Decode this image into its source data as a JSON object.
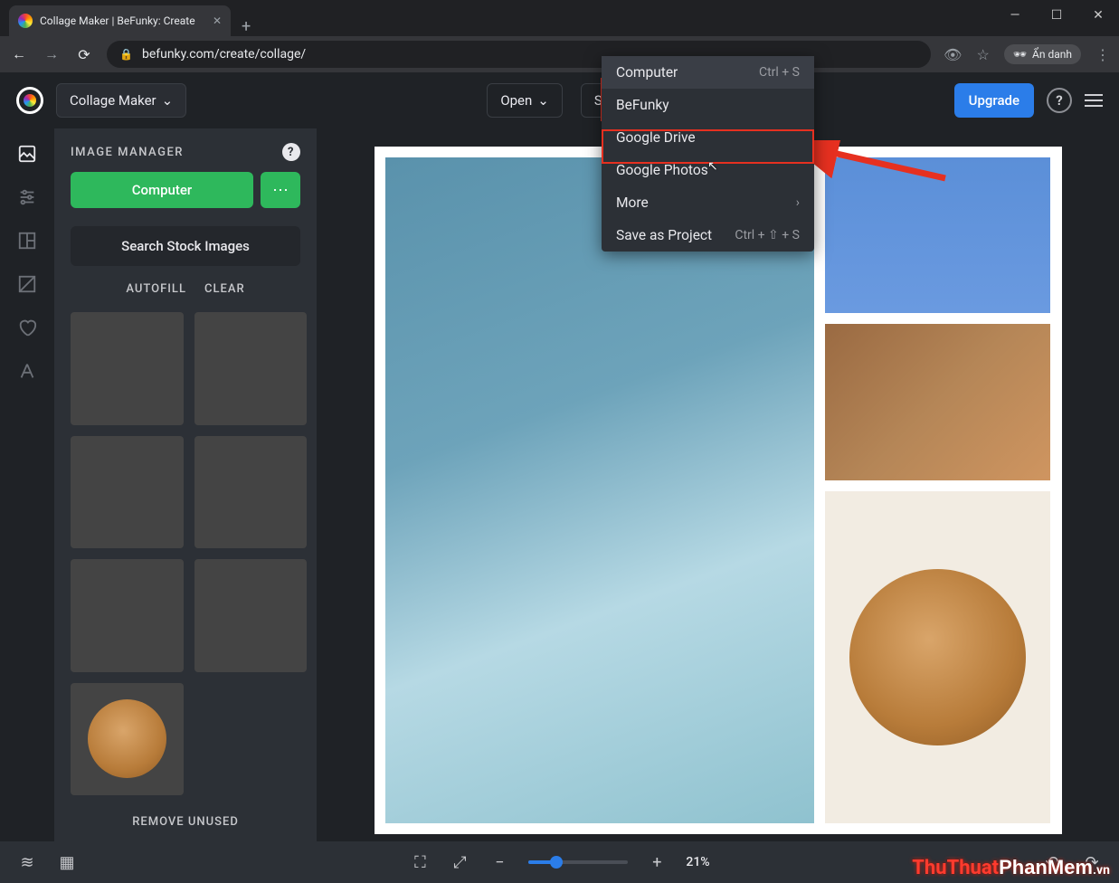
{
  "browser": {
    "tab_title": "Collage Maker | BeFunky: Create",
    "url": "befunky.com/create/collage/",
    "incognito_label": "Ẩn danh"
  },
  "header": {
    "app_switcher": "Collage Maker",
    "open": "Open",
    "save": "Save",
    "upgrade": "Upgrade"
  },
  "save_menu": {
    "items": [
      {
        "label": "Computer",
        "kbd": "Ctrl + S",
        "highlight": true
      },
      {
        "label": "BeFunky",
        "kbd": ""
      },
      {
        "label": "Google Drive",
        "kbd": ""
      },
      {
        "label": "Google Photos",
        "kbd": ""
      },
      {
        "label": "More",
        "kbd": "›"
      },
      {
        "label": "Save as Project",
        "kbd": "Ctrl + ⇧ + S"
      }
    ]
  },
  "sidebar": {
    "title": "IMAGE MANAGER",
    "computer_btn": "Computer",
    "stock_btn": "Search Stock Images",
    "autofill": "AUTOFILL",
    "clear": "CLEAR",
    "remove_unused": "REMOVE UNUSED"
  },
  "bottombar": {
    "zoom_pct": "21%"
  },
  "watermark": "ThuThuatPhanMem.vn"
}
